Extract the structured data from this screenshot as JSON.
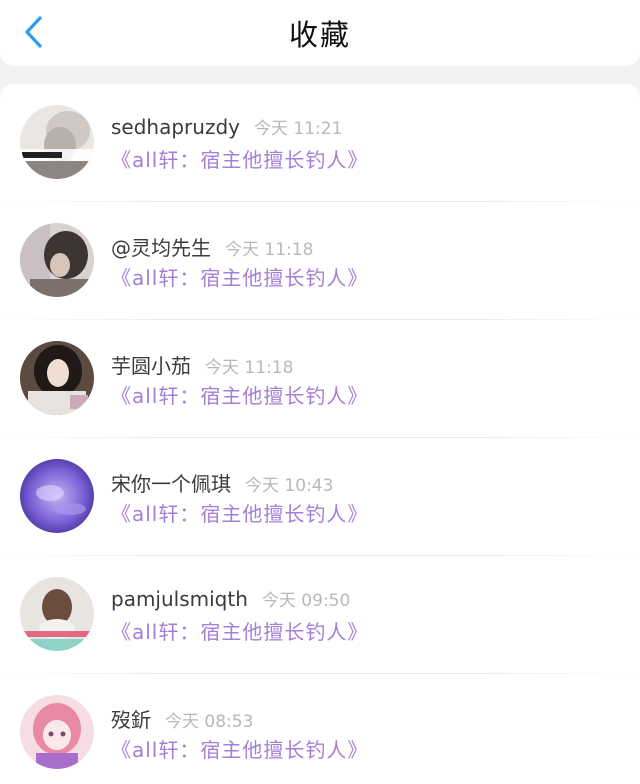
{
  "header": {
    "title": "收藏"
  },
  "icons": {
    "back": "chevron-left-icon",
    "back_color": "#2b9bf0"
  },
  "colors": {
    "work_title": "#a47fd8",
    "time": "#b8b8b8",
    "username": "#3b3b3b"
  },
  "items": [
    {
      "username": "sedhapruzdy",
      "time": "今天 11:21",
      "work_title": "《all轩：宿主他擅长钓人》"
    },
    {
      "username": "@灵均先生",
      "time": "今天 11:18",
      "work_title": "《all轩：宿主他擅长钓人》"
    },
    {
      "username": "芋圆小茄",
      "time": "今天 11:18",
      "work_title": "《all轩：宿主他擅长钓人》"
    },
    {
      "username": "宋你一个佩琪",
      "time": "今天 10:43",
      "work_title": "《all轩：宿主他擅长钓人》"
    },
    {
      "username": "pamjulsmiqth",
      "time": "今天 09:50",
      "work_title": "《all轩：宿主他擅长钓人》"
    },
    {
      "username": "歿釿",
      "time": "今天 08:53",
      "work_title": "《all轩：宿主他擅长钓人》"
    }
  ]
}
